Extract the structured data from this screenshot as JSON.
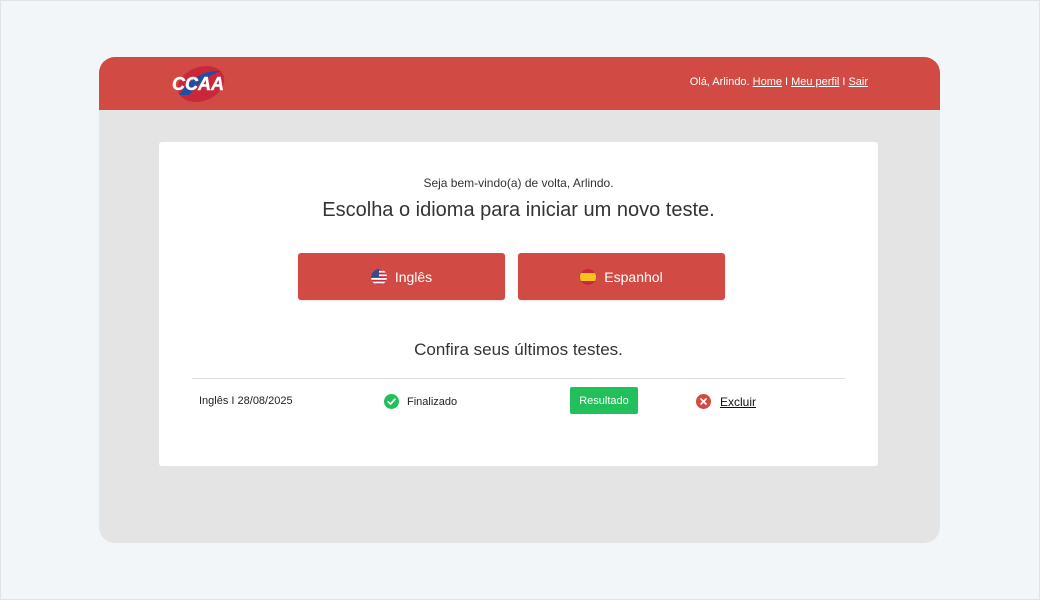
{
  "brand": {
    "logo_text": "CCAA",
    "primary_color": "#d14a43",
    "success_color": "#22c05a"
  },
  "header": {
    "greeting": "Olá, Arlindo.",
    "links": {
      "home": "Home",
      "profile": "Meu perfil",
      "logout": "Sair"
    },
    "separator": "I"
  },
  "main": {
    "welcome": "Seja bem-vindo(a) de volta, Arlindo.",
    "headline": "Escolha o idioma para iniciar um novo teste.",
    "languages": [
      {
        "label": "Inglês",
        "icon": "us-flag-icon"
      },
      {
        "label": "Espanhol",
        "icon": "spain-flag-icon"
      }
    ],
    "recent_title": "Confira seus últimos testes.",
    "tests": [
      {
        "test": "Inglês I 28/08/2025",
        "status": "Finalizado",
        "status_icon": "check-circle-icon",
        "result_label": "Resultado",
        "delete_label": "Excluir",
        "delete_icon": "x-circle-icon"
      }
    ]
  }
}
